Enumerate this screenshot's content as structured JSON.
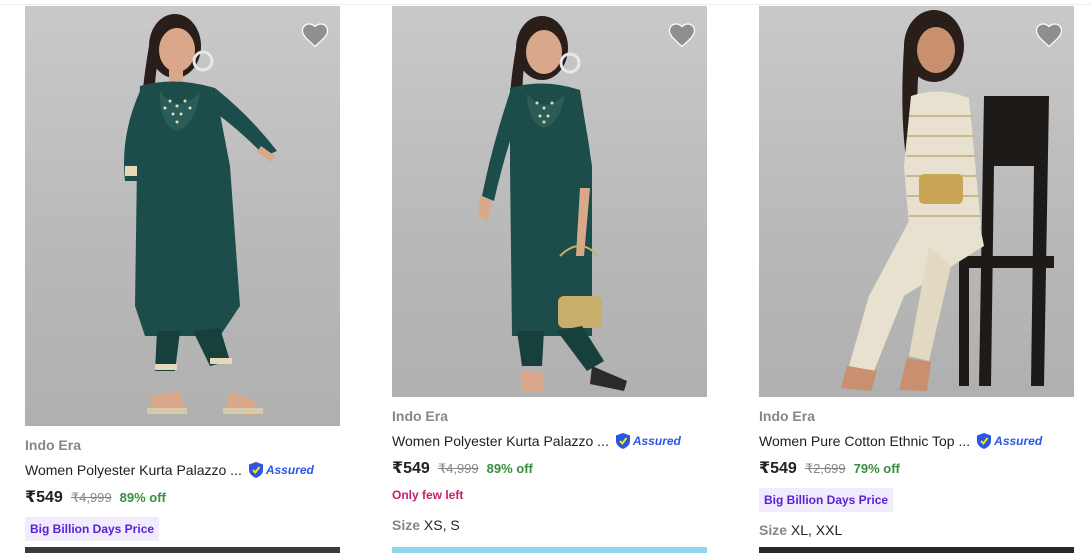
{
  "products": [
    {
      "brand": "Indo Era",
      "title": "Women Polyester Kurta Palazzo ...",
      "assured_label": "Assured",
      "price": "₹549",
      "mrp": "₹4,999",
      "discount": "89% off",
      "badge": "Big Billion Days Price",
      "stock": "",
      "size_label": "",
      "sizes": ""
    },
    {
      "brand": "Indo Era",
      "title": "Women Polyester Kurta Palazzo ...",
      "assured_label": "Assured",
      "price": "₹549",
      "mrp": "₹4,999",
      "discount": "89% off",
      "badge": "",
      "stock": "Only few left",
      "size_label": "Size",
      "sizes": "XS, S"
    },
    {
      "brand": "Indo Era",
      "title": "Women Pure Cotton Ethnic Top ...",
      "assured_label": "Assured",
      "price": "₹549",
      "mrp": "₹2,699",
      "discount": "79% off",
      "badge": "Big Billion Days Price",
      "stock": "",
      "size_label": "Size",
      "sizes": "XL, XXL"
    }
  ],
  "colors": {
    "accent_purple": "#5b21d6",
    "offer_green": "#388e3c",
    "stock_pink": "#c71f6b",
    "assured_blue": "#2a55e5"
  },
  "icons": {
    "wishlist": "heart-icon",
    "assured": "assured-shield-icon"
  }
}
